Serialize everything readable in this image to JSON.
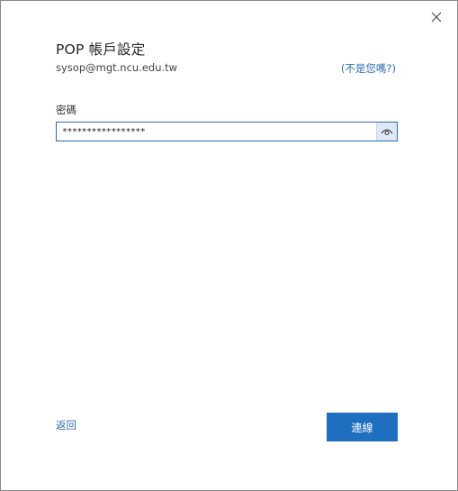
{
  "dialog": {
    "title": "POP 帳戶設定",
    "account_email": "sysop@mgt.ncu.edu.tw",
    "not_you_link": "(不是您嗎?)",
    "close_icon": "close-icon"
  },
  "password": {
    "label": "密碼",
    "value": "*****************",
    "reveal_icon": "eye-icon"
  },
  "footer": {
    "back_label": "返回",
    "connect_label": "連線"
  },
  "colors": {
    "accent": "#1e6fc0",
    "link": "#2b6cb0"
  }
}
